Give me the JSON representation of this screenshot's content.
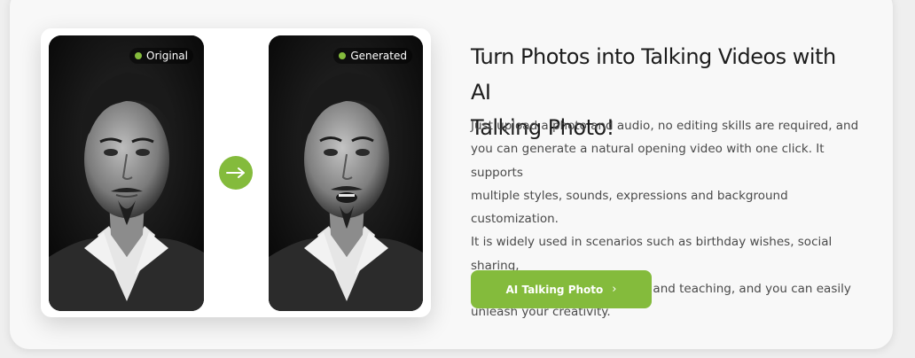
{
  "comparison": {
    "original_label": "Original",
    "generated_label": "Generated",
    "original_image_icon": "portrait-photo",
    "generated_image_icon": "portrait-photo-talking",
    "arrow_icon": "right-arrow-icon"
  },
  "content": {
    "headline_line1": "Turn Photos into Talking Videos with AI",
    "headline_line2": "Talking Photo!",
    "description_lines": [
      "Just upload a photo and audio, no editing skills are required, and",
      "you can generate a natural opening video with one click. It supports",
      "multiple styles, sounds, expressions and background customization.",
      "It is widely used in scenarios such as birthday wishes, social sharing,",
      "product promotion, education and teaching, and you can easily",
      "unleash your creativity."
    ]
  },
  "cta": {
    "label": "AI Talking Photo",
    "icon": "chevron-right-icon"
  },
  "colors": {
    "accent": "#84bb3c",
    "heading": "#1c1c1c",
    "body_text": "#4a4a4a",
    "card_bg": "#f8f8f8",
    "page_bg": "#efefef"
  }
}
